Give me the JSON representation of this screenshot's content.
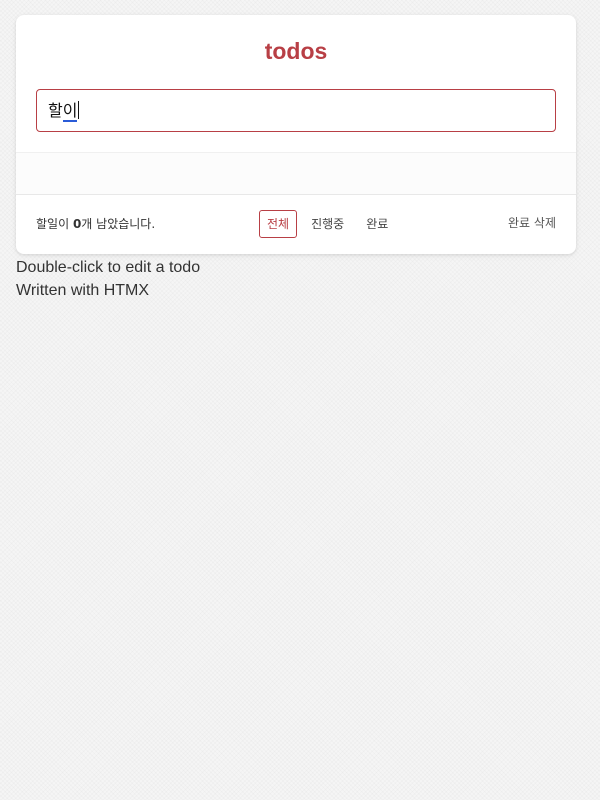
{
  "app": {
    "title": "todos"
  },
  "input": {
    "value_committed": "할",
    "value_composing": "이"
  },
  "footer": {
    "count_prefix": "할일이 ",
    "count_value": "0",
    "count_suffix": "개 남았습니다.",
    "filters": [
      {
        "label": "전체",
        "selected": true
      },
      {
        "label": "진행중",
        "selected": false
      },
      {
        "label": "완료",
        "selected": false
      }
    ],
    "clear_label": "완료 삭제"
  },
  "info": {
    "line1": "Double-click to edit a todo",
    "line2": "Written with HTMX"
  },
  "colors": {
    "accent": "#b83f45",
    "composition_underline": "#2a5bd7"
  }
}
